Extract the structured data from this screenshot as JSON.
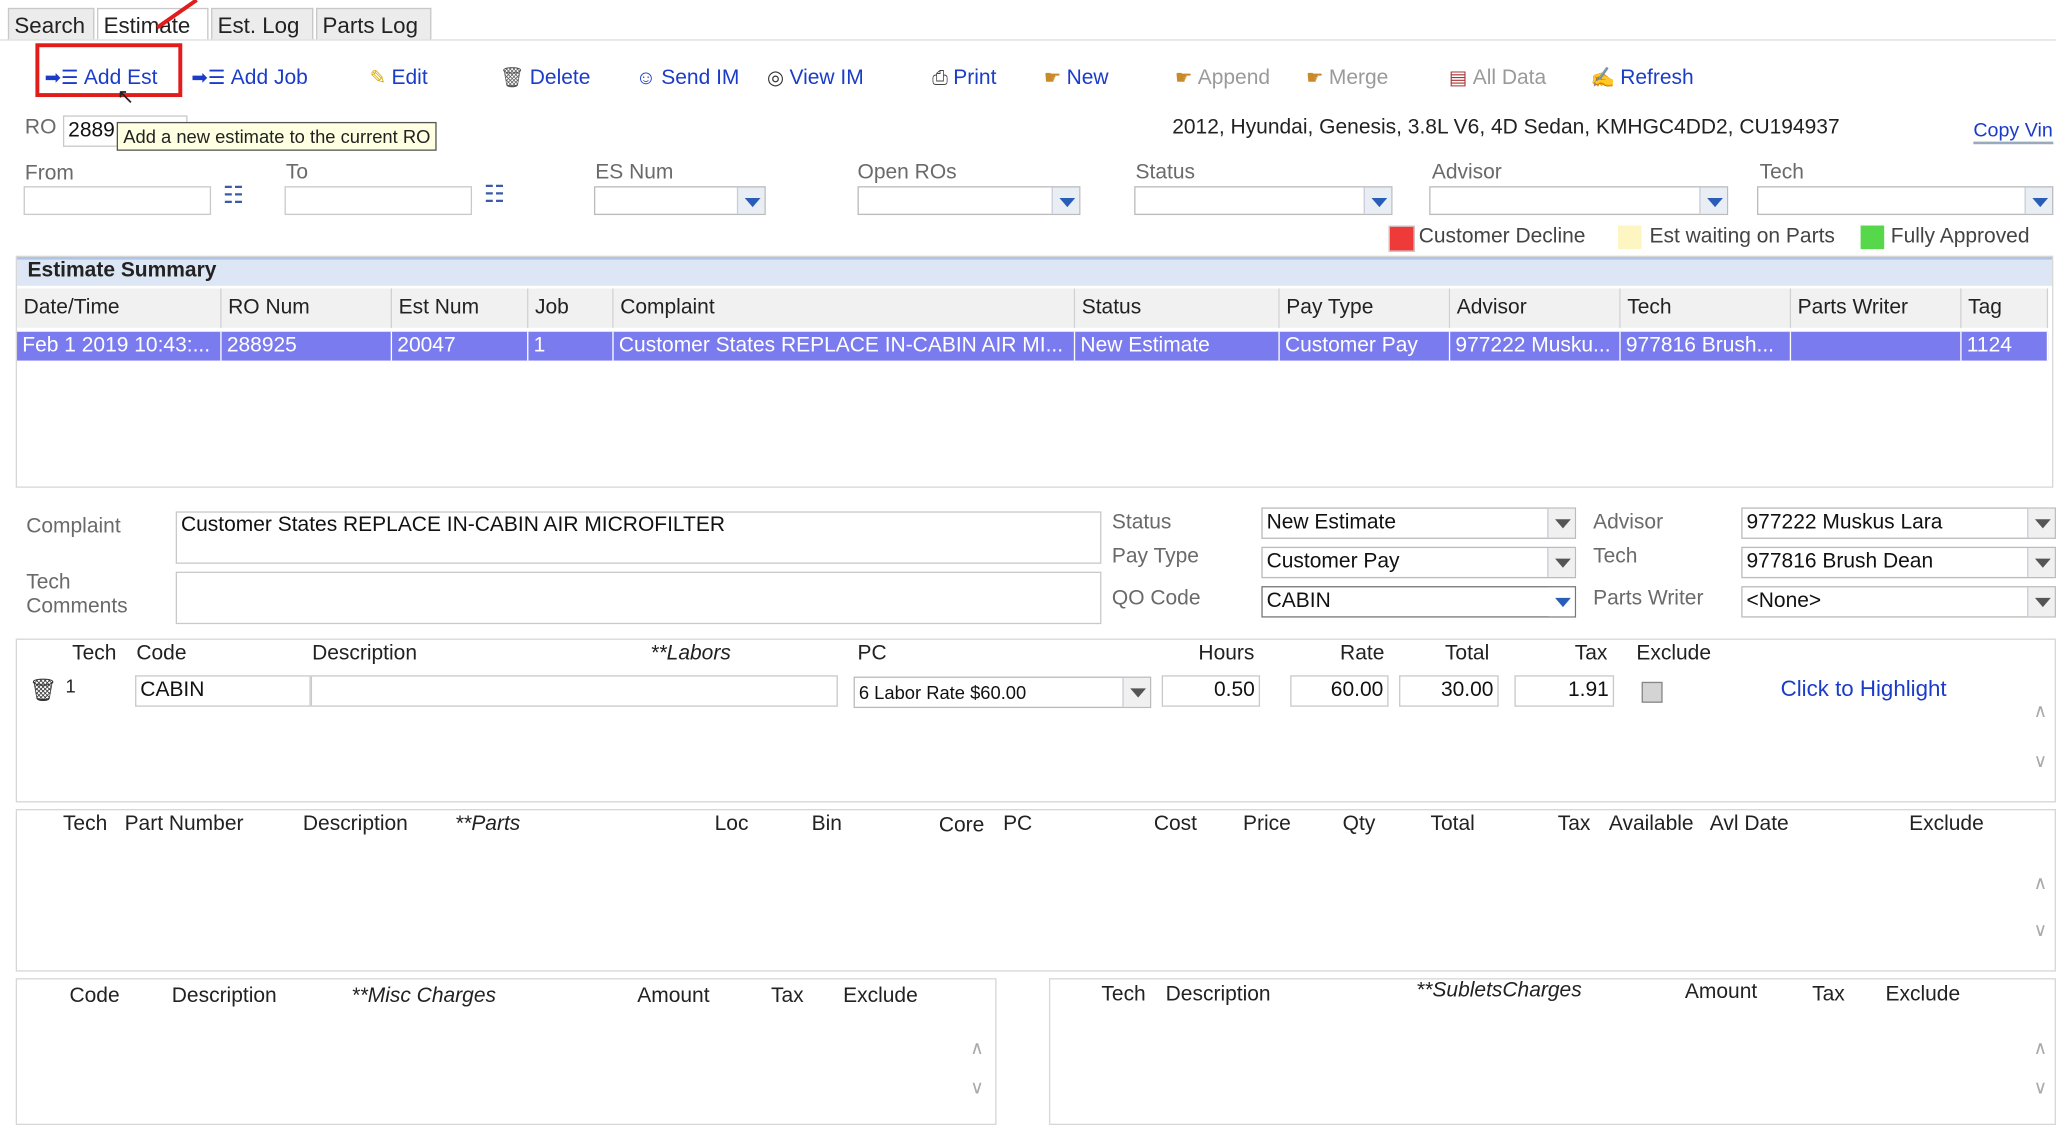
{
  "tabs": {
    "search": "Search",
    "estimate": "Estimate",
    "est_log": "Est. Log",
    "parts_log": "Parts Log"
  },
  "toolbar": {
    "add_est": "Add Est",
    "add_job": "Add Job",
    "edit": "Edit",
    "delete": "Delete",
    "send_im": "Send IM",
    "view_im": "View IM",
    "print": "Print",
    "new": "New",
    "append": "Append",
    "merge": "Merge",
    "all_data": "All Data",
    "refresh": "Refresh"
  },
  "tooltip": "Add a new estimate to the current RO",
  "ro": {
    "label": "RO",
    "value": "2889"
  },
  "vehicle": "2012, Hyundai, Genesis, 3.8L V6, 4D Sedan, KMHGC4DD2, CU194937",
  "copy_vin": "Copy Vin",
  "filters": {
    "from": "From",
    "to": "To",
    "es_num": "ES Num",
    "open_ros": "Open ROs",
    "status": "Status",
    "advisor": "Advisor",
    "tech": "Tech"
  },
  "legend": [
    {
      "label": "Customer Decline",
      "color": "#ef3a3a"
    },
    {
      "label": "Est waiting on Parts",
      "color": "#fdf6c3"
    },
    {
      "label": "Fully Approved",
      "color": "#56d84a"
    }
  ],
  "summary": {
    "title": "Estimate Summary",
    "columns": [
      "Date/Time",
      "RO Num",
      "Est Num",
      "Job",
      "Complaint",
      "Status",
      "Pay Type",
      "Advisor",
      "Tech",
      "Parts Writer",
      "Tag"
    ],
    "row": [
      "Feb 1 2019 10:43:...",
      "288925",
      "20047",
      "1",
      "Customer States REPLACE IN-CABIN AIR MI...",
      "New Estimate",
      "Customer Pay",
      "977222 Musku...",
      "977816 Brush...",
      "",
      "1124"
    ]
  },
  "detail": {
    "complaint_label": "Complaint",
    "complaint": "Customer States REPLACE IN-CABIN AIR MICROFILTER",
    "tech_label": "Tech",
    "comments_label": "Comments",
    "status_label": "Status",
    "status": "New Estimate",
    "pay_type_label": "Pay Type",
    "pay_type": "Customer Pay",
    "qo_code_label": "QO Code",
    "qo_code": "CABIN",
    "advisor_label": "Advisor",
    "advisor": "977222 Muskus Lara",
    "tech2_label": "Tech",
    "tech": "977816 Brush Dean",
    "parts_writer_label": "Parts Writer",
    "parts_writer": "<None>"
  },
  "labors": {
    "headers": {
      "tech": "Tech",
      "code": "Code",
      "description": "Description",
      "section": "**Labors",
      "pc": "PC",
      "hours": "Hours",
      "rate": "Rate",
      "total": "Total",
      "tax": "Tax",
      "exclude": "Exclude"
    },
    "row": {
      "tech": "1",
      "code": "CABIN",
      "description": "",
      "pc": "6 Labor Rate $60.00",
      "hours": "0.50",
      "rate": "60.00",
      "total": "30.00",
      "tax": "1.91"
    },
    "highlight": "Click to Highlight"
  },
  "parts": {
    "headers": {
      "tech": "Tech",
      "part_number": "Part Number",
      "description": "Description",
      "section": "**Parts",
      "loc": "Loc",
      "bin": "Bin",
      "core": "Core",
      "pc": "PC",
      "cost": "Cost",
      "price": "Price",
      "qty": "Qty",
      "total": "Total",
      "tax": "Tax",
      "available": "Available",
      "avl_date": "Avl Date",
      "exclude": "Exclude"
    }
  },
  "misc": {
    "headers": {
      "code": "Code",
      "description": "Description",
      "section": "**Misc Charges",
      "amount": "Amount",
      "tax": "Tax",
      "exclude": "Exclude"
    }
  },
  "sublets": {
    "headers": {
      "tech": "Tech",
      "description": "Description",
      "section": "**SubletsCharges",
      "amount": "Amount",
      "tax": "Tax",
      "exclude": "Exclude"
    }
  },
  "colors": {
    "selected_row": "#7b7bf0",
    "link": "#1a3cc8",
    "highlight_box": "#e21b1b",
    "header_band": "#dce6f4"
  }
}
